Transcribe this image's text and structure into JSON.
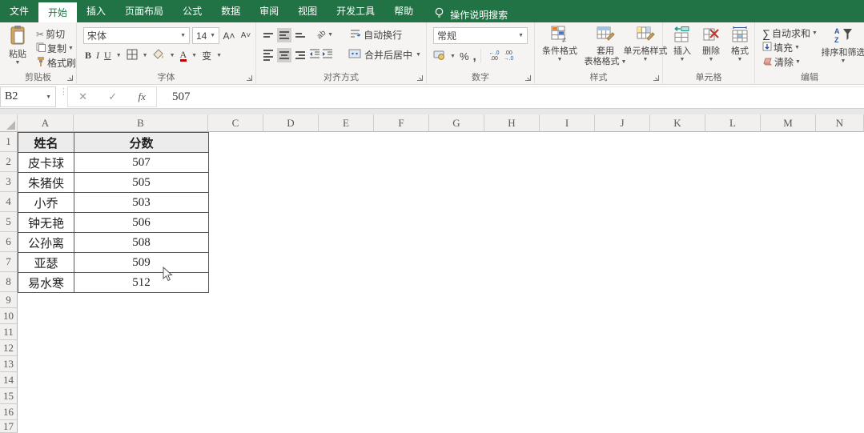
{
  "menu": {
    "tabs": [
      "文件",
      "开始",
      "插入",
      "页面布局",
      "公式",
      "数据",
      "审阅",
      "视图",
      "开发工具",
      "帮助"
    ],
    "active_tab": "开始",
    "search_label": "操作说明搜索"
  },
  "ribbon": {
    "clipboard": {
      "label": "剪贴板",
      "paste": "粘贴",
      "cut": "剪切",
      "copy": "复制",
      "format_painter": "格式刷"
    },
    "font": {
      "label": "字体",
      "font_name": "宋体",
      "font_size": "14",
      "bold": "B",
      "italic": "I",
      "underline": "U",
      "phonetic": "变"
    },
    "alignment": {
      "label": "对齐方式",
      "wrap_text": "自动换行",
      "merge_center": "合并后居中",
      "orientation_glyph": "ab"
    },
    "number": {
      "label": "数字",
      "format": "常规",
      "percent": "%",
      "comma": ",",
      "inc_dec_top": "←.0",
      "inc_dec_bottom": ".00",
      "dec_dec_top": ".00",
      "dec_dec_bottom": "→.0"
    },
    "styles": {
      "label": "样式",
      "conditional": "条件格式",
      "format_table_line1": "套用",
      "format_table_line2": "表格格式",
      "cell_styles": "单元格样式"
    },
    "cells": {
      "label": "单元格",
      "insert": "插入",
      "delete": "删除",
      "format": "格式"
    },
    "editing": {
      "label": "编辑",
      "autosum": "自动求和",
      "autosum_glyph": "∑",
      "fill": "填充",
      "clear": "清除",
      "sort_filter": "排序和筛选",
      "sort_a": "A",
      "sort_z": "Z"
    }
  },
  "formula_bar": {
    "name_box": "B2",
    "cancel_glyph": "✕",
    "enter_glyph": "✓",
    "fx_glyph": "fx",
    "value": "507"
  },
  "sheet": {
    "columns": [
      "A",
      "B",
      "C",
      "D",
      "E",
      "F",
      "G",
      "H",
      "I",
      "J",
      "K",
      "L",
      "M",
      "N"
    ],
    "rows": [
      "1",
      "2",
      "3",
      "4",
      "5",
      "6",
      "7",
      "8",
      "9",
      "10",
      "11",
      "12",
      "13",
      "14",
      "15",
      "16",
      "17"
    ],
    "table": {
      "headers": [
        "姓名",
        "分数"
      ],
      "rows": [
        [
          "皮卡球",
          "507"
        ],
        [
          "朱猪侠",
          "505"
        ],
        [
          "小乔",
          "503"
        ],
        [
          "钟无艳",
          "506"
        ],
        [
          "公孙离",
          "508"
        ],
        [
          "亚瑟",
          "509"
        ],
        [
          "易水寒",
          "512"
        ]
      ]
    }
  },
  "colors": {
    "brand_green": "#217346",
    "ribbon_bg": "#f5f4f2",
    "header_bg": "#f1f0ee",
    "table_header_fill": "#ececec",
    "table_border": "#595959",
    "accent_blue": "#2b579a",
    "delete_red": "#c0392b",
    "insert_teal": "#1a9988",
    "font_color_red": "#c00000"
  }
}
